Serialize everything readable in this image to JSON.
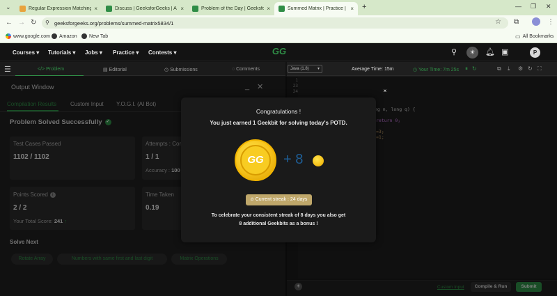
{
  "browser": {
    "tabs": [
      {
        "label": "Regular Expression Matching -",
        "active": false
      },
      {
        "label": "Discuss | GeeksforGeeks | A co",
        "active": false
      },
      {
        "label": "Problem of the Day | GeeksforG",
        "active": false
      },
      {
        "label": "Summed Matrix | Practice | Gee",
        "active": true
      }
    ],
    "new_tab": "+",
    "url": "geeksforgeeks.org/problems/summed-matrix5834/1",
    "bookmarks": [
      {
        "label": "www.google.com"
      },
      {
        "label": "Amazon"
      },
      {
        "label": "New Tab"
      }
    ],
    "all_bookmarks": "All Bookmarks"
  },
  "gfg_nav": {
    "menus": [
      "Courses",
      "Tutorials",
      "Jobs",
      "Practice",
      "Contests"
    ],
    "logo": "GG",
    "avatar": "P"
  },
  "problem_tabs": [
    "</> Problem",
    "Editorial",
    "Submissions",
    "Comments"
  ],
  "output": {
    "title": "Output Window",
    "subtabs": [
      "Compilation Results",
      "Custom Input",
      "Y.O.G.I. (AI Bot)"
    ],
    "status": "Problem Solved Successfully",
    "cards": {
      "test_cases": {
        "label": "Test Cases Passed",
        "value": "1102 / 1102"
      },
      "attempts": {
        "label": "Attempts : Corr",
        "value": "1 / 1",
        "sub_label": "Accuracy :",
        "sub_value": "100"
      },
      "points": {
        "label": "Points Scored",
        "value": "2 / 2",
        "sub_label": "Your Total Score:",
        "sub_value": "241"
      },
      "time": {
        "label": "Time Taken",
        "value": "0.19"
      }
    },
    "solve_next": "Solve Next",
    "suggestions": [
      "Rotate Array",
      "Numbers with same first and last digit",
      "Matrix Operations"
    ]
  },
  "editor": {
    "language": "Java (1.8)",
    "avg_time": "Average Time: 15m",
    "your_time": "Your Time: 7m 25s",
    "line_numbers": [
      "1",
      "23",
      "24"
    ],
    "code_lines": [
      "ng n, long q) {",
      "return 0;",
      "=3;",
      "=1;"
    ],
    "custom_input": "Custom Input",
    "compile_run": "Compile & Run",
    "submit": "Submit"
  },
  "modal": {
    "title": "Congratulations !",
    "subtitle": "You just earned 1 Geekbit for solving today's POTD.",
    "bonus": "+ 8",
    "streak": "Current streak : 24 days",
    "note_line1": "To celebrate your consistent streak of 8 days you also get",
    "note_line2": "8 additional Geekbits as a bonus !",
    "close": "×"
  },
  "icons": {
    "search": "search-icon",
    "theme": "sun-icon",
    "bell": "bell-icon",
    "cart": "cart-icon"
  },
  "colors": {
    "gfg_green": "#2f8d46",
    "coin_gold": "#f6c21a",
    "streak_badge": "#bfa76a"
  }
}
